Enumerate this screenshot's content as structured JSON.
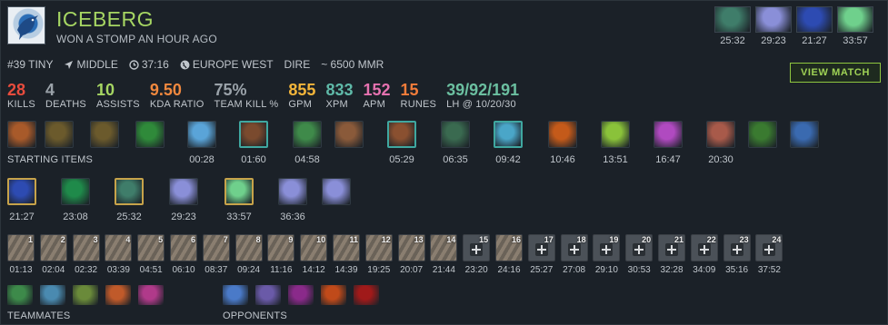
{
  "player": {
    "name": "ICEBERG",
    "status": "WON A STOMP AN HOUR AGO"
  },
  "meta": {
    "rank": "#39 TINY",
    "lane_icon": "lane-arrow-icon",
    "lane": "MIDDLE",
    "duration_icon": "clock-icon",
    "duration": "37:16",
    "region_icon": "globe-icon",
    "region": "EUROPE WEST",
    "side": "DIRE",
    "mmr": "~ 6500 MMR"
  },
  "view_match_label": "VIEW MATCH",
  "final_items": [
    {
      "time": "25:32",
      "icon": "tranquil-boots-icon",
      "color": "#3f7d6a"
    },
    {
      "time": "29:23",
      "icon": "hurricane-pike-icon",
      "color": "#8a8fd8"
    },
    {
      "time": "21:27",
      "icon": "echo-sabre-icon",
      "color": "#2d4bb2"
    },
    {
      "time": "33:57",
      "icon": "aghanims-icon",
      "color": "#6fd08c"
    }
  ],
  "stats": [
    {
      "value": "28",
      "label": "KILLS",
      "color": "#e84c3d"
    },
    {
      "value": "4",
      "label": "DEATHS",
      "color": "#9aa2a9"
    },
    {
      "value": "10",
      "label": "ASSISTS",
      "color": "#a6d663"
    },
    {
      "value": "9.50",
      "label": "KDA RATIO",
      "color": "#f0883e"
    },
    {
      "value": "75%",
      "label": "TEAM KILL %",
      "color": "#9aa2a9"
    },
    {
      "value": "855",
      "label": "GPM",
      "color": "#f3b53a"
    },
    {
      "value": "833",
      "label": "XPM",
      "color": "#5fb9a8"
    },
    {
      "value": "152",
      "label": "APM",
      "color": "#e672b0"
    },
    {
      "value": "15",
      "label": "RUNES",
      "color": "#f27c3a"
    },
    {
      "value": "39/92/191",
      "label": "LH @ 10/20/30",
      "color": "#6bbfa0"
    }
  ],
  "starting_items_label": "STARTING ITEMS",
  "item_row1": [
    {
      "icon": "tango-icon",
      "color": "#a85a2a",
      "time": ""
    },
    {
      "icon": "iron-branch-icon",
      "color": "#6b5a2c",
      "time": ""
    },
    {
      "icon": "iron-branch-icon",
      "color": "#6b5a2c",
      "time": ""
    },
    {
      "icon": "healing-salve-icon",
      "color": "#2f8a3a",
      "time": ""
    },
    {
      "icon": "bottle-icon",
      "color": "#5aa4d8",
      "time": "00:28"
    },
    {
      "icon": "boots-icon",
      "color": "#7a4a2e",
      "time": "01:60"
    },
    {
      "icon": "wraith-band-icon",
      "color": "#3f8a4a",
      "time": "04:58"
    },
    {
      "icon": "circlet-icon",
      "color": "#8a5a3a",
      "time": ""
    },
    {
      "icon": "power-treads-icon",
      "color": "#8a5030",
      "time": "05:29"
    },
    {
      "icon": "wand-icon",
      "color": "#3a6a50",
      "time": "06:35"
    },
    {
      "icon": "blink-icon",
      "color": "#4aa6c8",
      "time": "09:42"
    },
    {
      "icon": "mango-icon",
      "color": "#c45a1a",
      "time": "10:46"
    },
    {
      "icon": "sobi-icon",
      "color": "#8ac23a",
      "time": "13:51"
    },
    {
      "icon": "ogre-axe-icon",
      "color": "#b04ac0",
      "time": "16:47"
    },
    {
      "icon": "quarterstaff-icon",
      "color": "#a85a4a",
      "time": "20:30"
    },
    {
      "icon": "broadsword-icon",
      "color": "#3a7a30",
      "time": ""
    },
    {
      "icon": "staff-icon",
      "color": "#3a6ab0",
      "time": ""
    }
  ],
  "item_row2": [
    {
      "icon": "echo-sabre-icon",
      "color": "#2d4bb2",
      "time": "21:27"
    },
    {
      "icon": "shadow-blade-icon",
      "color": "#1f8a4a",
      "time": "23:08"
    },
    {
      "icon": "tranquil-boots-icon",
      "color": "#3f7d6a",
      "time": "25:32"
    },
    {
      "icon": "hurricane-pike-icon",
      "color": "#8a8fd8",
      "time": "29:23"
    },
    {
      "icon": "aghanims-icon",
      "color": "#6fd08c",
      "time": "33:57"
    },
    {
      "icon": "hurricane-pike-icon",
      "color": "#8a8fd8",
      "time": "36:36"
    },
    {
      "icon": "hurricane-pike-icon",
      "color": "#8a8fd8",
      "time": ""
    }
  ],
  "abilities": [
    {
      "n": "1",
      "time": "01:13",
      "talent": false
    },
    {
      "n": "2",
      "time": "02:04",
      "talent": false
    },
    {
      "n": "3",
      "time": "02:32",
      "talent": false
    },
    {
      "n": "4",
      "time": "03:39",
      "talent": false
    },
    {
      "n": "5",
      "time": "04:51",
      "talent": false
    },
    {
      "n": "6",
      "time": "06:10",
      "talent": false
    },
    {
      "n": "7",
      "time": "08:37",
      "talent": false
    },
    {
      "n": "8",
      "time": "09:24",
      "talent": false
    },
    {
      "n": "9",
      "time": "11:16",
      "talent": false
    },
    {
      "n": "10",
      "time": "14:12",
      "talent": false
    },
    {
      "n": "11",
      "time": "14:39",
      "talent": false
    },
    {
      "n": "12",
      "time": "19:25",
      "talent": false
    },
    {
      "n": "13",
      "time": "20:07",
      "talent": false
    },
    {
      "n": "14",
      "time": "21:44",
      "talent": false
    },
    {
      "n": "15",
      "time": "23:20",
      "talent": true
    },
    {
      "n": "16",
      "time": "24:16",
      "talent": false
    },
    {
      "n": "17",
      "time": "25:27",
      "talent": true
    },
    {
      "n": "18",
      "time": "27:08",
      "talent": true
    },
    {
      "n": "19",
      "time": "29:10",
      "talent": true
    },
    {
      "n": "20",
      "time": "30:53",
      "talent": true
    },
    {
      "n": "21",
      "time": "32:28",
      "talent": true
    },
    {
      "n": "22",
      "time": "34:09",
      "talent": true
    },
    {
      "n": "23",
      "time": "35:16",
      "talent": true
    },
    {
      "n": "24",
      "time": "37:52",
      "talent": true
    }
  ],
  "teammates_label": "TEAMMATES",
  "opponents_label": "OPPONENTS",
  "teammates": [
    {
      "icon": "hero-icon",
      "color": "#3d8a4a"
    },
    {
      "icon": "hero-icon",
      "color": "#4a8ab0"
    },
    {
      "icon": "hero-icon",
      "color": "#6a8a3a"
    },
    {
      "icon": "hero-icon",
      "color": "#c05a2a"
    },
    {
      "icon": "hero-icon",
      "color": "#b03a8a"
    }
  ],
  "opponents": [
    {
      "icon": "hero-icon",
      "color": "#4a7ac8"
    },
    {
      "icon": "hero-icon",
      "color": "#6a5aa8"
    },
    {
      "icon": "hero-icon",
      "color": "#8a2a8a"
    },
    {
      "icon": "hero-icon",
      "color": "#c04a1a"
    },
    {
      "icon": "hero-icon",
      "color": "#a01a1a"
    }
  ]
}
